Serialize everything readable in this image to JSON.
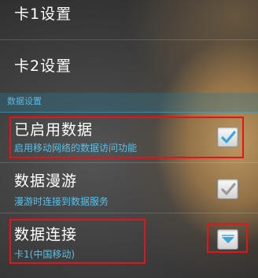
{
  "items": {
    "sim1": {
      "title": "卡1设置"
    },
    "sim2": {
      "title": "卡2设置"
    }
  },
  "section": {
    "label": "数据设置"
  },
  "data_enabled": {
    "title": "已启用数据",
    "summary": "启用移动网络的数据访问功能",
    "checked": true,
    "icon": "checkmark-icon"
  },
  "data_roaming": {
    "title": "数据漫游",
    "summary": "漫游时连接到数据服务",
    "checked": true,
    "icon": "checkmark-icon"
  },
  "data_connection": {
    "title": "数据连接",
    "summary": "卡1(中国移动)",
    "icon": "dropdown-triangle-icon"
  },
  "colors": {
    "accent": "#5bc0e8",
    "highlight": "#e5141a",
    "check_active": "#3aa6d8",
    "check_inactive": "#9a9a9a"
  }
}
